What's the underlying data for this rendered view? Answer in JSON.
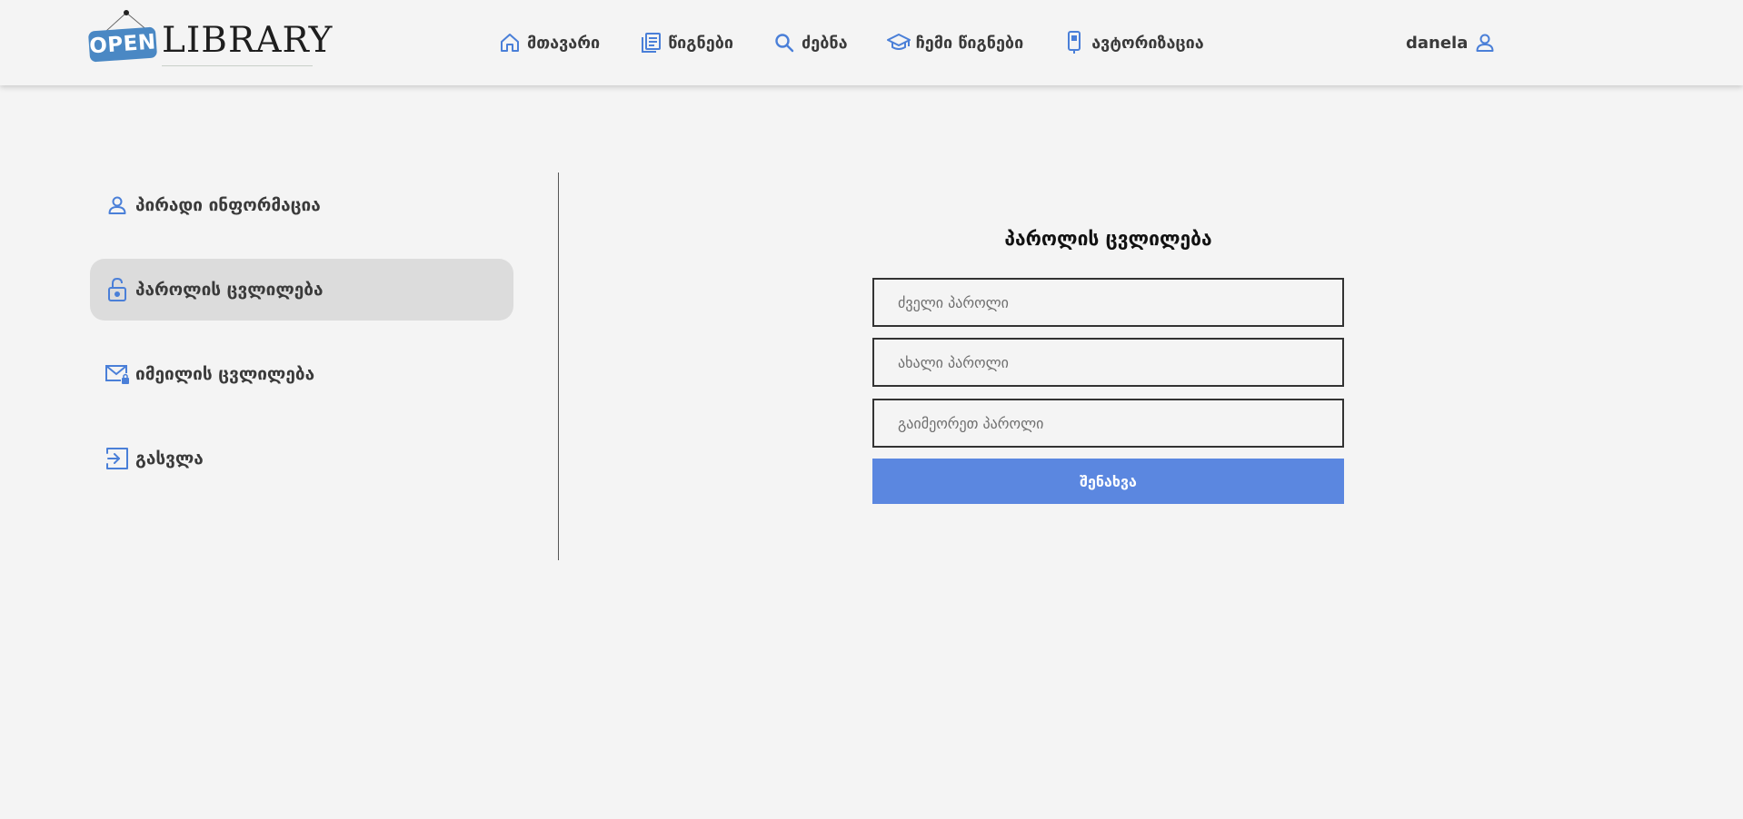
{
  "header": {
    "logo": {
      "open_text": "OPEN",
      "library_text": "LIBRARY"
    },
    "nav": [
      {
        "label": "მთავარი",
        "icon": "home-icon"
      },
      {
        "label": "წიგნები",
        "icon": "books-icon"
      },
      {
        "label": "ძებნა",
        "icon": "search-icon"
      },
      {
        "label": "ჩემი წიგნები",
        "icon": "graduation-cap-icon"
      },
      {
        "label": "ავტორიზაცია",
        "icon": "usb-key-icon"
      }
    ],
    "user": {
      "name": "danela",
      "icon": "user-icon"
    }
  },
  "sidebar": {
    "items": [
      {
        "label": "პირადი ინფორმაცია",
        "icon": "user-icon",
        "active": false
      },
      {
        "label": "პაროლის ცვლილება",
        "icon": "lock-open-icon",
        "active": true
      },
      {
        "label": "იმეილის ცვლილება",
        "icon": "mail-lock-icon",
        "active": false
      },
      {
        "label": "გასვლა",
        "icon": "logout-icon",
        "active": false
      }
    ]
  },
  "form": {
    "title": "პაროლის ცვლილება",
    "old_password_placeholder": "ძველი პაროლი",
    "new_password_placeholder": "ახალი პაროლი",
    "repeat_password_placeholder": "გაიმეორეთ პაროლი",
    "submit_label": "შენახვა"
  },
  "colors": {
    "accent": "#5b87e0",
    "icon": "#4a7fd8",
    "background": "#f4f4f4",
    "active_item": "#dcdcdc",
    "logo_blue": "#4a88c4"
  }
}
